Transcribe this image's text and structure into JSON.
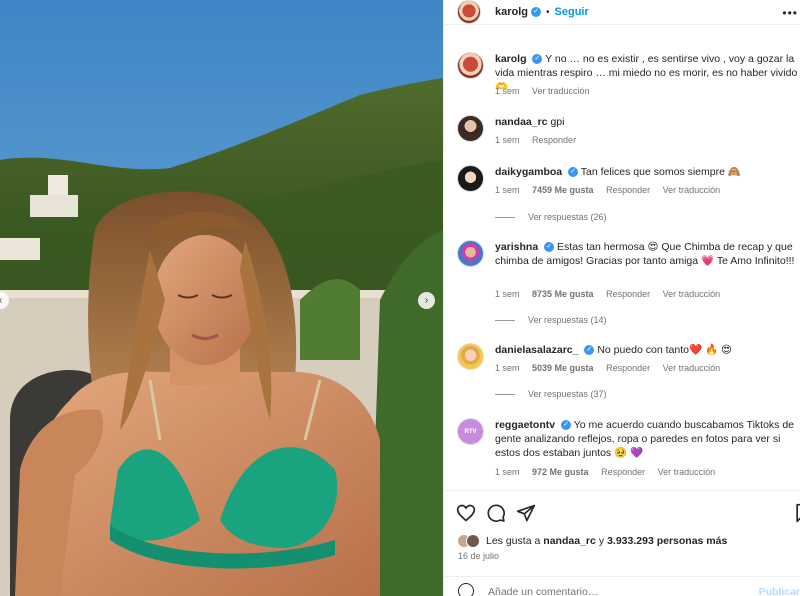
{
  "header": {
    "username": "karolg",
    "follow_label": "Seguir",
    "separator": "•",
    "more_label": "•••"
  },
  "caption": {
    "username": "karolg",
    "text": "Y no … no es existir , es sentirse vivo , voy a gozar la vida mientras respiro … mi miedo no es morir, es no haber vivido 🫶",
    "age": "1 sem",
    "translate": "Ver traducción"
  },
  "comments": [
    {
      "username": "nandaa_rc",
      "verified": false,
      "text": "gpi",
      "age": "1 sem",
      "likes": "",
      "reply": "Responder",
      "translate": "",
      "view_replies": ""
    },
    {
      "username": "daikygamboa",
      "verified": true,
      "text": "Tan felices que somos siempre 🙈",
      "age": "1 sem",
      "likes": "7459 Me gusta",
      "reply": "Responder",
      "translate": "Ver traducción",
      "view_replies": "Ver respuestas (26)"
    },
    {
      "username": "yarishna",
      "verified": true,
      "text": "Estas tan hermosa 😍 Que Chimba de recap y que chimba de amigos! Gracias por tanto amiga 💗 Te Amo Infinito!!!",
      "age": "1 sem",
      "likes": "8735 Me gusta",
      "reply": "Responder",
      "translate": "Ver traducción",
      "view_replies": "Ver respuestas (14)"
    },
    {
      "username": "danielasalazarc_",
      "verified": true,
      "text": "No puedo con tanto❤️ 🔥 😍",
      "age": "1 sem",
      "likes": "5039 Me gusta",
      "reply": "Responder",
      "translate": "Ver traducción",
      "view_replies": "Ver respuestas (37)"
    },
    {
      "username": "reggaetontv",
      "verified": true,
      "text": "Yo me acuerdo cuando buscabamos Tiktoks de gente analizando reflejos, ropa o paredes en fotos para ver si estos dos estaban juntos 🥹 💜",
      "age": "1 sem",
      "likes": "972 Me gusta",
      "reply": "Responder",
      "translate": "Ver traducción",
      "view_replies": ""
    }
  ],
  "likes_summary": {
    "prefix": "Les gusta a",
    "first_user": "nandaa_rc",
    "middle": "y",
    "others": "3.933.293 personas más"
  },
  "post_date": "16 de julio",
  "comment_box": {
    "placeholder": "Añade un comentario…",
    "post_label": "Publicar"
  },
  "icons": {
    "like": "heart-icon",
    "comment": "comment-bubble-icon",
    "share": "paper-plane-icon",
    "save": "bookmark-icon",
    "emoji": "smiley-icon",
    "next": "chevron-right-icon",
    "prev": "chevron-left-icon",
    "verified": "verified-badge-icon"
  },
  "colors": {
    "accent": "#0095f6",
    "verified": "#3897f0",
    "muted": "#737373"
  }
}
